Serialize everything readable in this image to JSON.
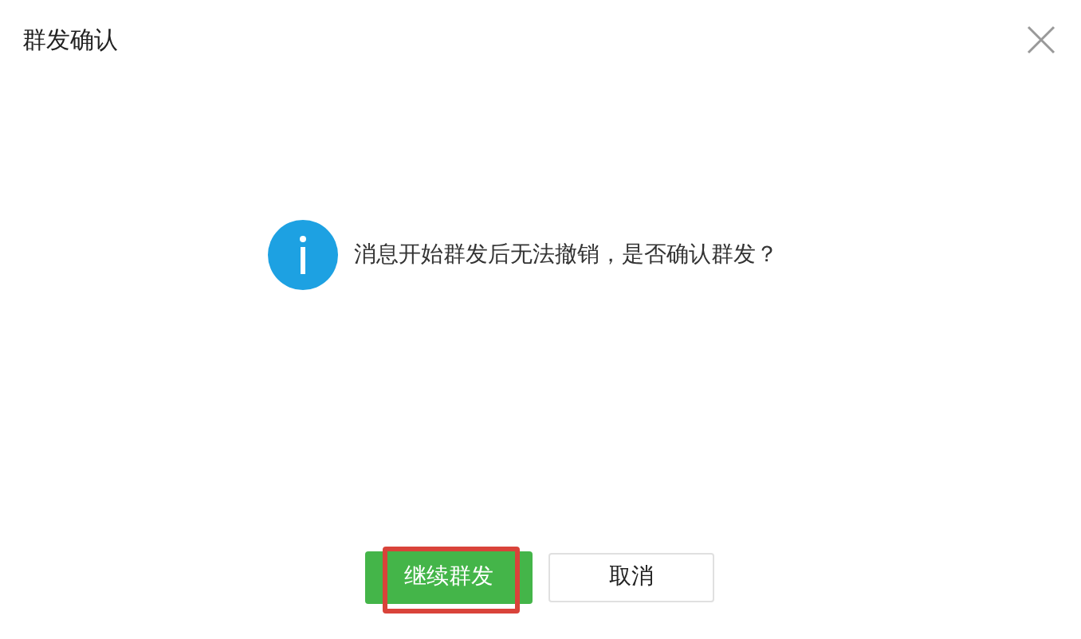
{
  "dialog": {
    "title": "群发确认",
    "message": "消息开始群发后无法撤销，是否确认群发？"
  },
  "buttons": [
    {
      "label": "继续群发",
      "kind": "primary",
      "highlighted": true
    },
    {
      "label": "取消",
      "kind": "default",
      "highlighted": false
    }
  ]
}
